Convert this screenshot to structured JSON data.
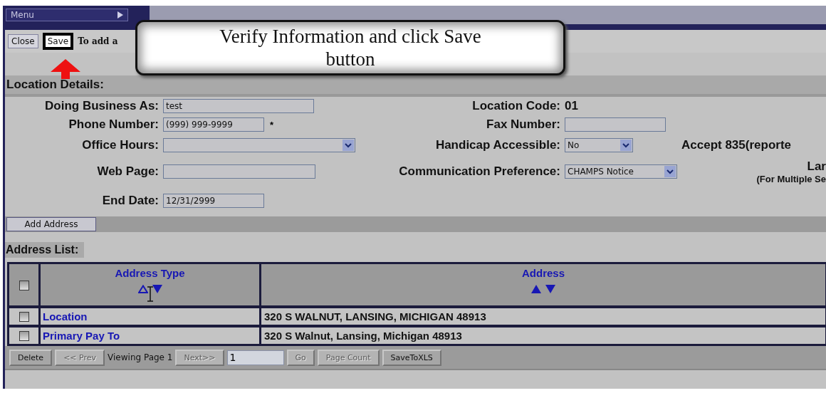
{
  "menu": {
    "label": "Menu"
  },
  "toolbar": {
    "buttons": [
      {
        "label": "Close",
        "highlighted": false
      },
      {
        "label": "Save",
        "highlighted": true
      }
    ],
    "hint": "To add a"
  },
  "callout": {
    "text": "Verify Information and click Save button"
  },
  "section_title": "Location Details:",
  "form": {
    "rows": [
      {
        "left": {
          "label": "Doing Business As:",
          "kind": "text",
          "value": "test"
        },
        "right": {
          "label": "Location Code:",
          "kind": "static",
          "value": "01"
        }
      },
      {
        "left": {
          "label": "Phone Number:",
          "kind": "text",
          "value": "(999) 999-9999",
          "required_mark": "*"
        },
        "right": {
          "label": "Fax Number:",
          "kind": "text"
        }
      },
      {
        "left": {
          "label": "Office Hours:",
          "kind": "select"
        },
        "right": {
          "label": "Handicap Accessible:",
          "kind": "select",
          "value": "No"
        },
        "extra": {
          "title": "Accept 835(reporte"
        }
      },
      {
        "left": {
          "label": "Web Page:",
          "kind": "text"
        },
        "right": {
          "label": "Communication Preference:",
          "kind": "select",
          "value": "CHAMPS Notice"
        },
        "extra": {
          "title": "Lar",
          "note": "(For Multiple Se"
        }
      },
      {
        "left": {
          "label": "End Date:",
          "kind": "text",
          "value": "12/31/2999"
        }
      }
    ]
  },
  "add_address_button": "Add Address",
  "address_list": {
    "title": "Address List:",
    "header_checked": false,
    "columns": [
      {
        "label": "Address Type",
        "up_hovered": true
      },
      {
        "label": "Address",
        "up_hovered": false
      }
    ],
    "rows": [
      {
        "checked": false,
        "type": "Location",
        "address": "320 S WALNUT, LANSING, MICHIGAN 48913"
      },
      {
        "checked": false,
        "type": "Primary Pay To",
        "address": "320 S Walnut, Lansing, Michigan 48913"
      }
    ]
  },
  "pager": [
    {
      "kind": "button",
      "label": "Delete",
      "disabled": false
    },
    {
      "kind": "button",
      "label": "<< Prev",
      "disabled": true
    },
    {
      "kind": "text",
      "label": "Viewing Page 1"
    },
    {
      "kind": "button",
      "label": "Next>>",
      "disabled": true
    },
    {
      "kind": "input",
      "label": "1"
    },
    {
      "kind": "button",
      "label": "Go",
      "disabled": true
    },
    {
      "kind": "button",
      "label": "Page Count",
      "disabled": true
    },
    {
      "kind": "button",
      "label": "SaveToXLS",
      "disabled": false
    }
  ]
}
